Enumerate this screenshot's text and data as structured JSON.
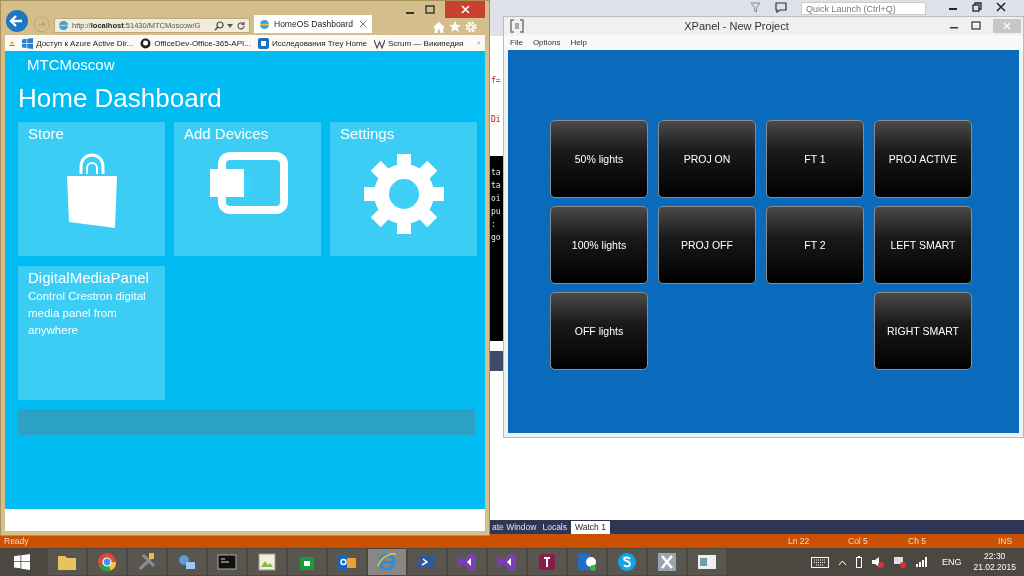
{
  "ide": {
    "quick_launch": {
      "placeholder": "Quick Launch (Ctrl+Q)"
    },
    "editor_lines": [
      "f=",
      "Di"
    ],
    "console_lines": [
      "ta",
      "ta",
      "oi",
      "pu",
      ":",
      "go"
    ],
    "panel_tabs": [
      {
        "label": "ate Window",
        "selected": false
      },
      {
        "label": "Locals",
        "selected": false
      },
      {
        "label": "Watch 1",
        "selected": true
      }
    ],
    "status_bar": {
      "state": "Ready",
      "line": "Ln 22",
      "column": "Col 5",
      "char": "Ch 5",
      "mode": "INS"
    }
  },
  "browser": {
    "address": "http://**localhost**:51430/MTCMoscow/G",
    "tab": {
      "title": "HomeOS Dashboard",
      "selected": true
    },
    "favorites": [
      {
        "label": "Доступ к Azure Active Dir...",
        "kind": "windows"
      },
      {
        "label": "OfficeDev-Office-365-API...",
        "kind": "github"
      },
      {
        "label": "Исследования Trey Home",
        "kind": "sharepoint"
      },
      {
        "label": "Scrum — Википедия",
        "kind": "wikipedia"
      }
    ],
    "page": {
      "site": "MTCMoscow",
      "heading": "Home Dashboard",
      "tiles": [
        {
          "title": "Store",
          "kind": "store"
        },
        {
          "title": "Add Devices",
          "kind": "devices"
        },
        {
          "title": "Settings",
          "kind": "settings"
        },
        {
          "title": "DigitalMediaPanel",
          "kind": "text",
          "description": "Control Crestron digital media panel from anywhere"
        }
      ]
    }
  },
  "xpanel": {
    "title": "XPanel - New Project",
    "menu": [
      "File",
      "Options",
      "Help"
    ],
    "button_rows": [
      [
        {
          "kind": "button",
          "label": "50% lights"
        },
        {
          "kind": "button",
          "label": "PROJ ON"
        },
        {
          "kind": "button",
          "label": "FT 1"
        },
        {
          "kind": "button",
          "label": "PROJ ACTIVE"
        }
      ],
      [
        {
          "kind": "button",
          "label": "100% lights"
        },
        {
          "kind": "button",
          "label": "PROJ OFF"
        },
        {
          "kind": "button",
          "label": "FT 2"
        },
        {
          "kind": "button",
          "label": "LEFT SMART"
        }
      ],
      [
        {
          "kind": "button",
          "label": "OFF lights"
        },
        {
          "kind": "blank"
        },
        {
          "kind": "blank"
        },
        {
          "kind": "button",
          "label": "RIGHT SMART"
        }
      ]
    ]
  },
  "taskbar": {
    "apps": [
      {
        "kind": "folder",
        "selected": false
      },
      {
        "kind": "chrome",
        "selected": false
      },
      {
        "kind": "tools",
        "selected": false
      },
      {
        "kind": "network",
        "selected": false
      },
      {
        "kind": "console",
        "selected": false
      },
      {
        "kind": "image",
        "selected": false
      },
      {
        "kind": "store",
        "selected": false
      },
      {
        "kind": "outlook",
        "selected": false
      },
      {
        "kind": "ie",
        "selected": true
      },
      {
        "kind": "powershell",
        "selected": false
      },
      {
        "kind": "vs",
        "selected": false
      },
      {
        "kind": "vs",
        "selected": false
      },
      {
        "kind": "tile",
        "selected": false
      },
      {
        "kind": "lync",
        "selected": false
      },
      {
        "kind": "skype",
        "selected": false
      },
      {
        "kind": "xpanel",
        "selected": false
      },
      {
        "kind": "window",
        "selected": false
      }
    ],
    "tray": {
      "language": "ENG",
      "time": "22:30",
      "date": "21.02.2015"
    }
  }
}
